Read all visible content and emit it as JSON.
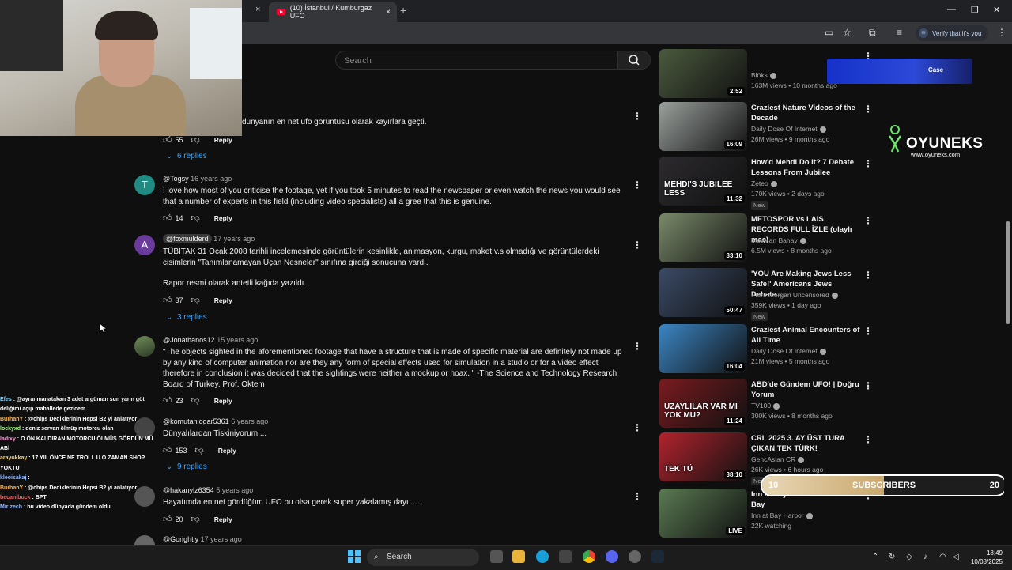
{
  "browser": {
    "tab_title": "(10) İstanbul / Kumburgaz UFO",
    "tab_close": "×",
    "new_tab": "+",
    "verify_label": "Verify that it's you"
  },
  "youtube": {
    "search_placeholder": "Search"
  },
  "comments": [
    {
      "text": "dünyanın en net ufo görüntüsü olarak kayırlara geçti.",
      "likes": "55",
      "reply": "Reply",
      "replies": "6 replies"
    },
    {
      "avatar_letter": "T",
      "avatar_color": "#1f8b83",
      "author": "@Togsy",
      "ago": "16 years ago",
      "text": "I love how most of you criticise the footage, yet if you took 5 minutes to read the newspaper or even watch the news you would see that a number of experts in this field (including video specialists) all a gree that this is genuine.",
      "likes": "14",
      "reply": "Reply"
    },
    {
      "avatar_letter": "A",
      "avatar_color": "#6a3b9c",
      "author": "@foxmulderd",
      "ago": "17 years ago",
      "text": "TÜBİTAK 31 Ocak 2008 tarihli incelemesinde görüntülerin kesinlikle, animasyon, kurgu, maket v.s olmadığı ve görüntülerdeki cisimlerin \"Tanımlanamayan Uçan Nesneler\" sınıfına girdiği sonucuna vardı.",
      "text2": "Rapor resmi olarak antetli kağıda yazıldı.",
      "likes": "37",
      "reply": "Reply",
      "replies": "3 replies"
    },
    {
      "author": "@Jonathanos12",
      "ago": "15 years ago",
      "text": "\"The objects sighted in the aforementioned footage that have a structure that is made of specific material are definitely not made up by any kind of computer animation nor are they any form of special effects used for simulation in a studio or for a video effect therefore in conclusion it was decided that the sightings were neither a mockup or hoax. \" -The Science and Technology Research Board of Turkey.  Prof. Oktem",
      "likes": "23",
      "reply": "Reply"
    },
    {
      "author": "@komutanlogar5361",
      "ago": "6 years ago",
      "text": "Dünyalılardan Tiskiniyorum ...",
      "likes": "153",
      "reply": "Reply",
      "replies": "9 replies"
    },
    {
      "author": "@hakanylz6354",
      "ago": "5 years ago",
      "text": "Hayatımda en net gördüğüm UFO bu olsa gerek super yakalamış dayı ....",
      "likes": "20",
      "reply": "Reply"
    },
    {
      "author": "@Gorightly",
      "ago": "17 years ago"
    }
  ],
  "sidebar": [
    {
      "title": "",
      "channel": "Blöks",
      "meta": "163M views • 10 months ago",
      "duration": "2:52",
      "color": "#4b5a3e"
    },
    {
      "title": "Craziest Nature Videos of the Decade",
      "channel": "Daily Dose Of Internet",
      "meta": "26M views • 9 months ago",
      "duration": "16:09",
      "color": "#9aa09c"
    },
    {
      "title": "How'd Mehdi Do It? 7 Debate Lessons From Jubilee",
      "channel": "Zeteo",
      "meta": "170K views • 2 days ago",
      "duration": "11:32",
      "badge": "New",
      "thumb_text": "MEHDI'S JUBILEE LESS",
      "color": "#2c2a2e"
    },
    {
      "title": "METOSPOR vs LAIS RECORDS FULL İZLE (olaylı maç)",
      "channel": "Mevtcan Bahav",
      "meta": "6.5M views • 8 months ago",
      "duration": "33:10",
      "color": "#7a8a6a"
    },
    {
      "title": "'YOU Are Making Jews Less Safe!' Americans Jews Debate...",
      "channel": "Piers Morgan Uncensored",
      "meta": "359K views • 1 day ago",
      "duration": "50:47",
      "badge": "New",
      "color": "#3a4a66"
    },
    {
      "title": "Craziest Animal Encounters of All Time",
      "channel": "Daily Dose Of Internet",
      "meta": "21M views • 5 months ago",
      "duration": "16:04",
      "color": "#3b86c4"
    },
    {
      "title": "ABD'de Gündem UFO! | Doğru Yorum",
      "channel": "TV100",
      "meta": "300K views • 8 months ago",
      "duration": "11:24",
      "thumb_text": "UZAYLILAR VAR MI YOK MU?",
      "color": "#7a1b1f"
    },
    {
      "title": "CRL 2025 3. AY ÜST TURA ÇIKAN TEK TÜRK!",
      "channel": "GencAslan CR",
      "meta": "26K views • 6 hours ago",
      "duration": "38:10",
      "badge": "New",
      "thumb_text": "TEK TÜ",
      "color": "#b2232d"
    },
    {
      "title": "Inn at Bay Harbor Traverse Bay",
      "channel": "Inn at Bay Harbor",
      "meta": "22K watching",
      "duration": "LIVE",
      "color": "#5a7a52"
    }
  ],
  "chat": [
    {
      "user": "Efes",
      "user_color": "#7fd4ff",
      "msg": ": @ayranmanatakan 3 adet argüman sun yarın göt deliğimi açıp mahallede gezicem"
    },
    {
      "user": "BurhanY",
      "user_color": "#ffb347",
      "msg": ": @chips Dediklerinin Hepsi B2 yi anlatıyor"
    },
    {
      "user": "lockyxd",
      "user_color": "#9cff7a",
      "msg": ": deniz servan ölmüş motorcu olan"
    },
    {
      "user": "ladixy",
      "user_color": "#ff8fd2",
      "msg": ": O ÖN KALDIRAN MOTORCU ÖLMÜŞ GÖRDÜN MÜ ABİ"
    },
    {
      "user": "arayokkay",
      "user_color": "#ffd36b",
      "msg": ": 17 YIL ÖNCE NE TROLL U O ZAMAN SHOP YOKTU"
    },
    {
      "user": "kleoisakaj",
      "user_color": "#8fb6ff",
      "msg": ":"
    },
    {
      "user": "BurhanY",
      "user_color": "#ffb347",
      "msg": ": @chips Dediklerinin Hepsi B2 yi anlatıyor"
    },
    {
      "user": "becanibuck",
      "user_color": "#ff5c5c",
      "msg": ": BPT"
    },
    {
      "user": "Mirlzech",
      "user_color": "#8fb6ff",
      "msg": ": bu video dünyada gündem oldu"
    }
  ],
  "overlay": {
    "brand_name": "OYUNEKS",
    "brand_url": "www.oyuneks.com",
    "sub_current": "10",
    "sub_label": "SUBSCRIBERS",
    "sub_goal": "20",
    "sub_progress": 0.5,
    "case_label": "Case"
  },
  "taskbar": {
    "search_label": "Search",
    "time": "18:49",
    "date": "10/08/2025"
  }
}
